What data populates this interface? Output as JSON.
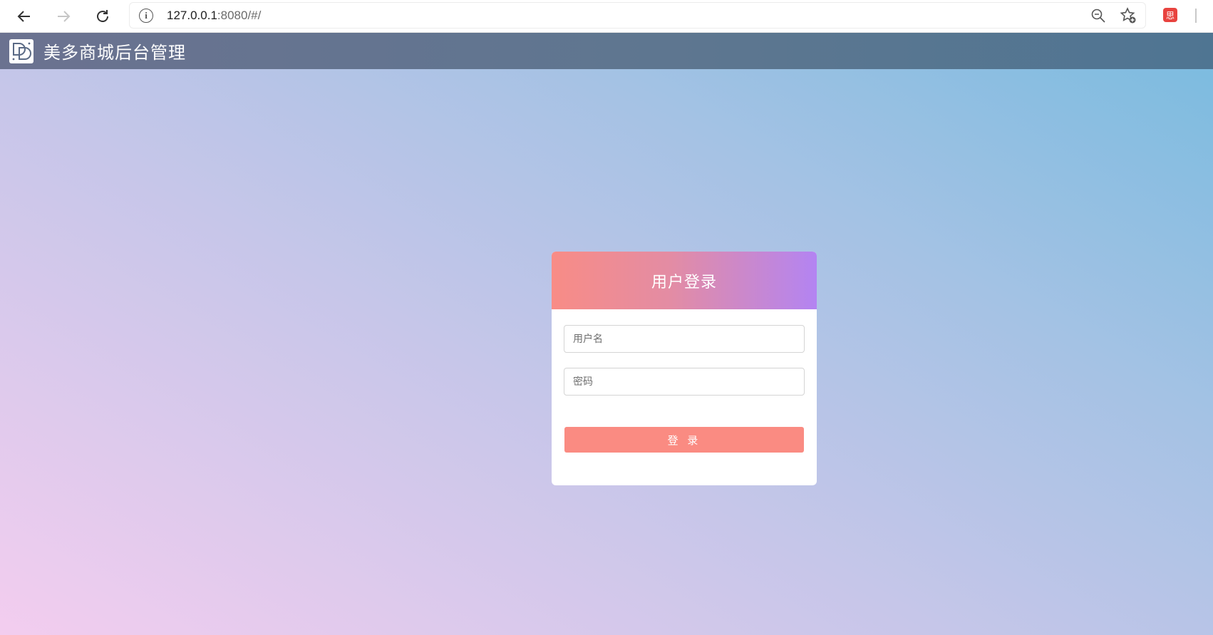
{
  "browser": {
    "url_host": "127.0.0.1",
    "url_rest": ":8080/#/",
    "ext_label": "思"
  },
  "app": {
    "title": "美多商城后台管理"
  },
  "login": {
    "title": "用户登录",
    "username_placeholder": "用户名",
    "password_placeholder": "密码",
    "submit_label": "登 录"
  },
  "colors": {
    "header_gradient_start": "#6b7290",
    "header_gradient_end": "#4f7592",
    "card_header_start": "#f88c86",
    "card_header_end": "#b384f2",
    "button": "#fa8b82"
  }
}
